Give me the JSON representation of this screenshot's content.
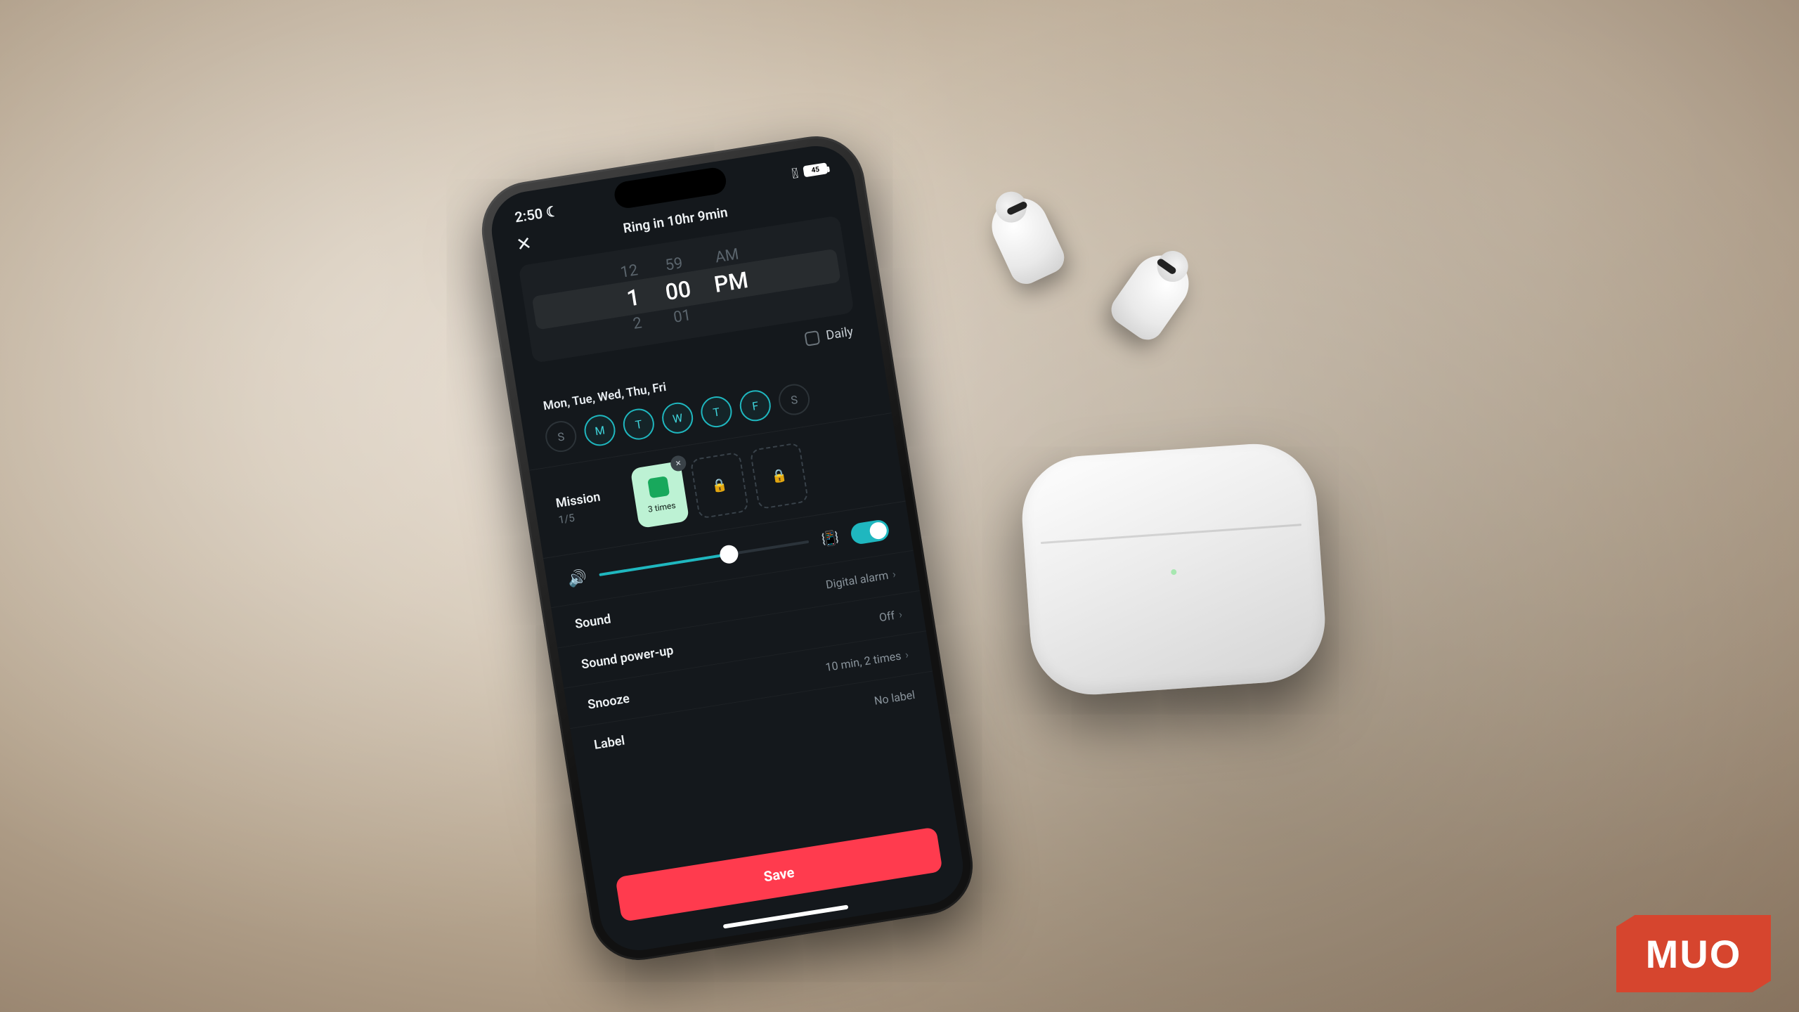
{
  "statusbar": {
    "time": "2:50",
    "battery": "45"
  },
  "header": {
    "title": "Ring in 10hr 9min"
  },
  "time_picker": {
    "hour_prev": "12",
    "hour_sel": "1",
    "hour_next": "2",
    "min_prev": "59",
    "min_sel": "00",
    "min_next": "01",
    "ampm_prev": "AM",
    "ampm_sel": "PM"
  },
  "daily": {
    "label": "Daily"
  },
  "days": {
    "summary": "Mon, Tue, Wed, Thu, Fri",
    "items": [
      {
        "letter": "S",
        "on": false
      },
      {
        "letter": "M",
        "on": true
      },
      {
        "letter": "T",
        "on": true
      },
      {
        "letter": "W",
        "on": true
      },
      {
        "letter": "T",
        "on": true
      },
      {
        "letter": "F",
        "on": true
      },
      {
        "letter": "S",
        "on": false
      }
    ]
  },
  "mission": {
    "title": "Mission",
    "count": "1/5",
    "active_caption": "3 times"
  },
  "sound": {
    "title": "Sound",
    "value": "Digital alarm",
    "powerup_title": "Sound power-up",
    "powerup_value": "Off"
  },
  "snooze": {
    "title": "Snooze",
    "value": "10 min, 2 times"
  },
  "label": {
    "title": "Label",
    "value": "No label"
  },
  "save": {
    "label": "Save"
  },
  "brand": {
    "text": "MUO"
  }
}
